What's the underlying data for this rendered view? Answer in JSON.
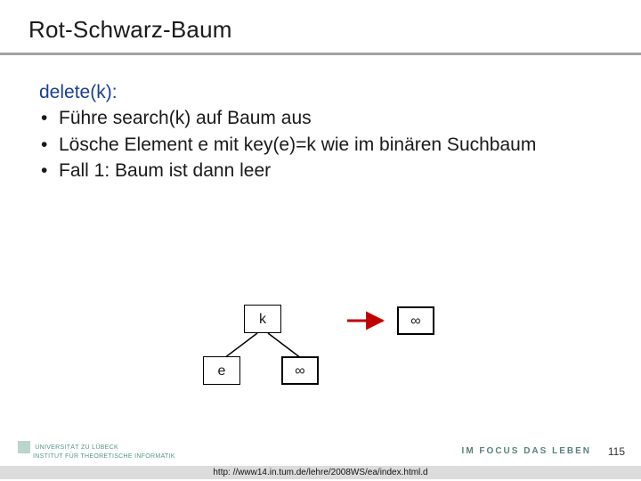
{
  "title": "Rot-Schwarz-Baum",
  "fn_heading": "delete(k):",
  "bullets": [
    "Führe search(k) auf Baum aus",
    "Lösche Element e mit key(e)=k wie im binären Suchbaum",
    "Fall 1: Baum ist dann leer"
  ],
  "nodes": {
    "root": "k",
    "left_child": "e",
    "right_child": "∞",
    "result": "∞"
  },
  "footer_url": "http: //www14.in.tum.de/lehre/2008WS/ea/index.html.d",
  "page_number": "115",
  "logo_left_line1": "UNIVERSITÄT ZU LÜBECK",
  "logo_left_line2": "INSTITUT FÜR THEORETISCHE INFORMATIK",
  "logo_right": "IM FOCUS DAS LEBEN"
}
